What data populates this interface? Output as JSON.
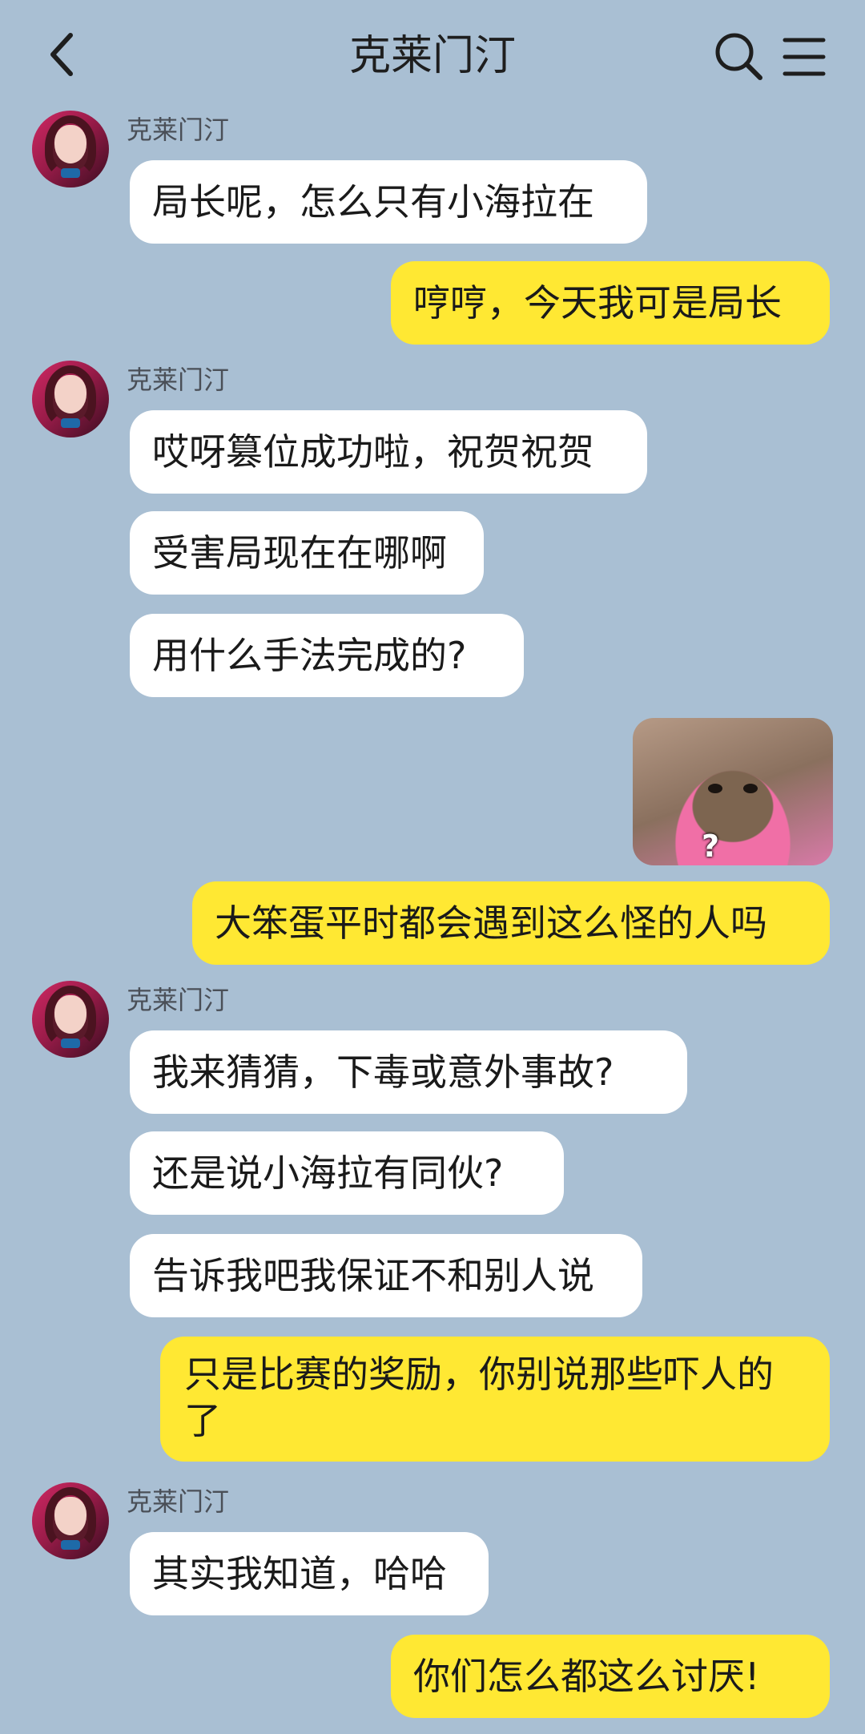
{
  "header": {
    "title": "克莱门汀",
    "back_icon": "chevron-left-icon",
    "search_icon": "search-icon",
    "menu_icon": "menu-icon"
  },
  "contact": {
    "name": "克莱门汀"
  },
  "messages": [
    {
      "side": "in",
      "text": "局长呢，怎么只有小海拉在"
    },
    {
      "side": "out",
      "text": "哼哼，今天我可是局长"
    },
    {
      "side": "in",
      "text": "哎呀篡位成功啦，祝贺祝贺"
    },
    {
      "side": "in",
      "text": "受害局现在在哪啊"
    },
    {
      "side": "in",
      "text": "用什么手法完成的?"
    },
    {
      "side": "out",
      "type": "image",
      "caption": "?"
    },
    {
      "side": "out",
      "text": "大笨蛋平时都会遇到这么怪的人吗"
    },
    {
      "side": "in",
      "text": "我来猜猜，下毒或意外事故?"
    },
    {
      "side": "in",
      "text": "还是说小海拉有同伙?"
    },
    {
      "side": "in",
      "text": "告诉我吧我保证不和别人说"
    },
    {
      "side": "out",
      "text": "只是比赛的奖励，你别说那些吓人的了"
    },
    {
      "side": "in",
      "text": "其实我知道，哈哈"
    },
    {
      "side": "out",
      "text": "你们怎么都这么讨厌!"
    }
  ],
  "colors": {
    "background": "#a9bfd3",
    "incoming_bubble": "#ffffff",
    "outgoing_bubble": "#ffe833"
  }
}
